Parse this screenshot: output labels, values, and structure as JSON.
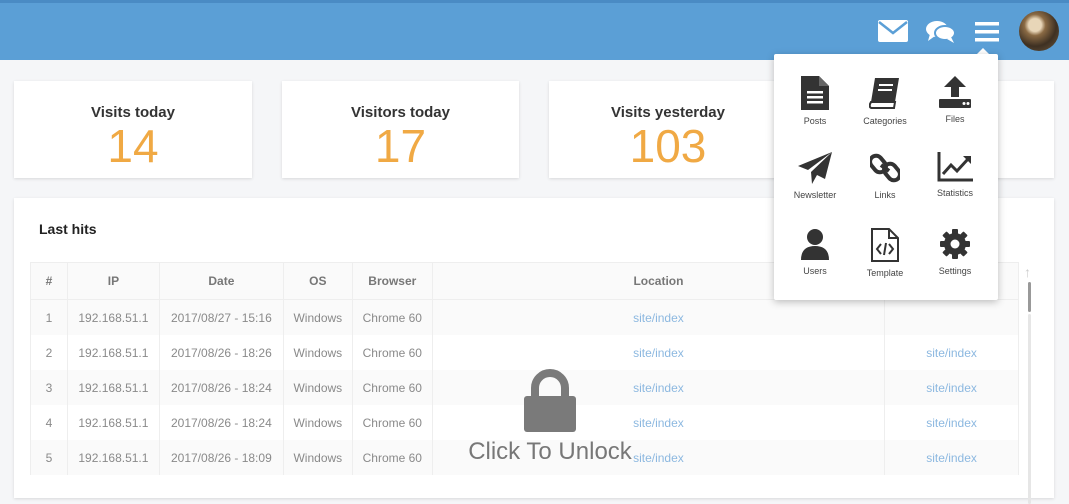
{
  "header": {
    "icons": [
      "envelope-icon",
      "chat-icon",
      "hamburger-menu-icon"
    ],
    "colors": {
      "bar": "#5b9fd6",
      "accent": "#f0a944"
    }
  },
  "stats": [
    {
      "label": "Visits today",
      "value": "14"
    },
    {
      "label": "Visitors today",
      "value": "17"
    },
    {
      "label": "Visits yesterday",
      "value": "103"
    }
  ],
  "hits_panel": {
    "title": "Last hits",
    "columns": [
      "#",
      "IP",
      "Date",
      "OS",
      "Browser",
      "Location"
    ],
    "rows": [
      {
        "n": "1",
        "ip": "192.168.51.1",
        "date": "2017/08/27 - 15:16",
        "os": "Windows",
        "browser": "Chrome 60",
        "location": "site/index",
        "extra": ""
      },
      {
        "n": "2",
        "ip": "192.168.51.1",
        "date": "2017/08/26 - 18:26",
        "os": "Windows",
        "browser": "Chrome 60",
        "location": "site/index",
        "extra": "site/index"
      },
      {
        "n": "3",
        "ip": "192.168.51.1",
        "date": "2017/08/26 - 18:24",
        "os": "Windows",
        "browser": "Chrome 60",
        "location": "site/index",
        "extra": "site/index"
      },
      {
        "n": "4",
        "ip": "192.168.51.1",
        "date": "2017/08/26 - 18:24",
        "os": "Windows",
        "browser": "Chrome 60",
        "location": "site/index",
        "extra": "site/index"
      },
      {
        "n": "5",
        "ip": "192.168.51.1",
        "date": "2017/08/26 - 18:09",
        "os": "Windows",
        "browser": "Chrome 60",
        "location": "site/index",
        "extra": "site/index"
      }
    ]
  },
  "lock": {
    "label": "Click To Unlock",
    "icon": "padlock-icon"
  },
  "menu": {
    "items": [
      {
        "label": "Posts",
        "icon": "document-icon"
      },
      {
        "label": "Categories",
        "icon": "book-icon"
      },
      {
        "label": "Files",
        "icon": "upload-icon"
      },
      {
        "label": "Newsletter",
        "icon": "paper-plane-icon"
      },
      {
        "label": "Links",
        "icon": "link-icon"
      },
      {
        "label": "Statistics",
        "icon": "line-chart-icon"
      },
      {
        "label": "Users",
        "icon": "user-icon"
      },
      {
        "label": "Template",
        "icon": "code-file-icon"
      },
      {
        "label": "Settings",
        "icon": "gear-icon"
      }
    ]
  }
}
